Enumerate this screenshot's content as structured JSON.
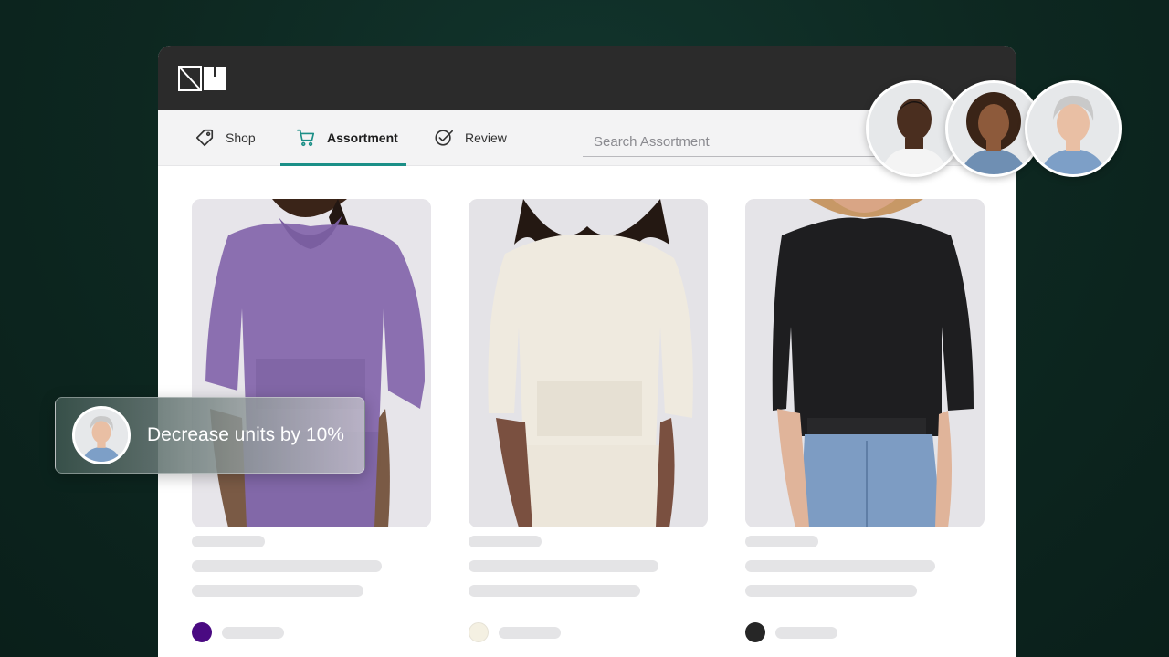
{
  "nav": {
    "tabs": [
      {
        "label": "Shop",
        "icon": "tag-icon"
      },
      {
        "label": "Assortment",
        "icon": "cart-icon",
        "active": true
      },
      {
        "label": "Review",
        "icon": "check-circle-icon"
      }
    ],
    "search_placeholder": "Search Assortment"
  },
  "colors": {
    "accent": "#1b8f87",
    "titlebar": "#2b2b2b",
    "background": "#0d2720",
    "swatch_purple": "#4a0a82",
    "swatch_cream": "#f4f0e2",
    "swatch_black": "#262626"
  },
  "products": [
    {
      "garment": "purple hoodie",
      "swatch": "#4a0a82"
    },
    {
      "garment": "cream hoodie",
      "swatch": "#f4f0e2"
    },
    {
      "garment": "black sweatshirt",
      "swatch": "#262626"
    }
  ],
  "toast": {
    "message": "Decrease units by 10%"
  },
  "collaborators_count": 3
}
